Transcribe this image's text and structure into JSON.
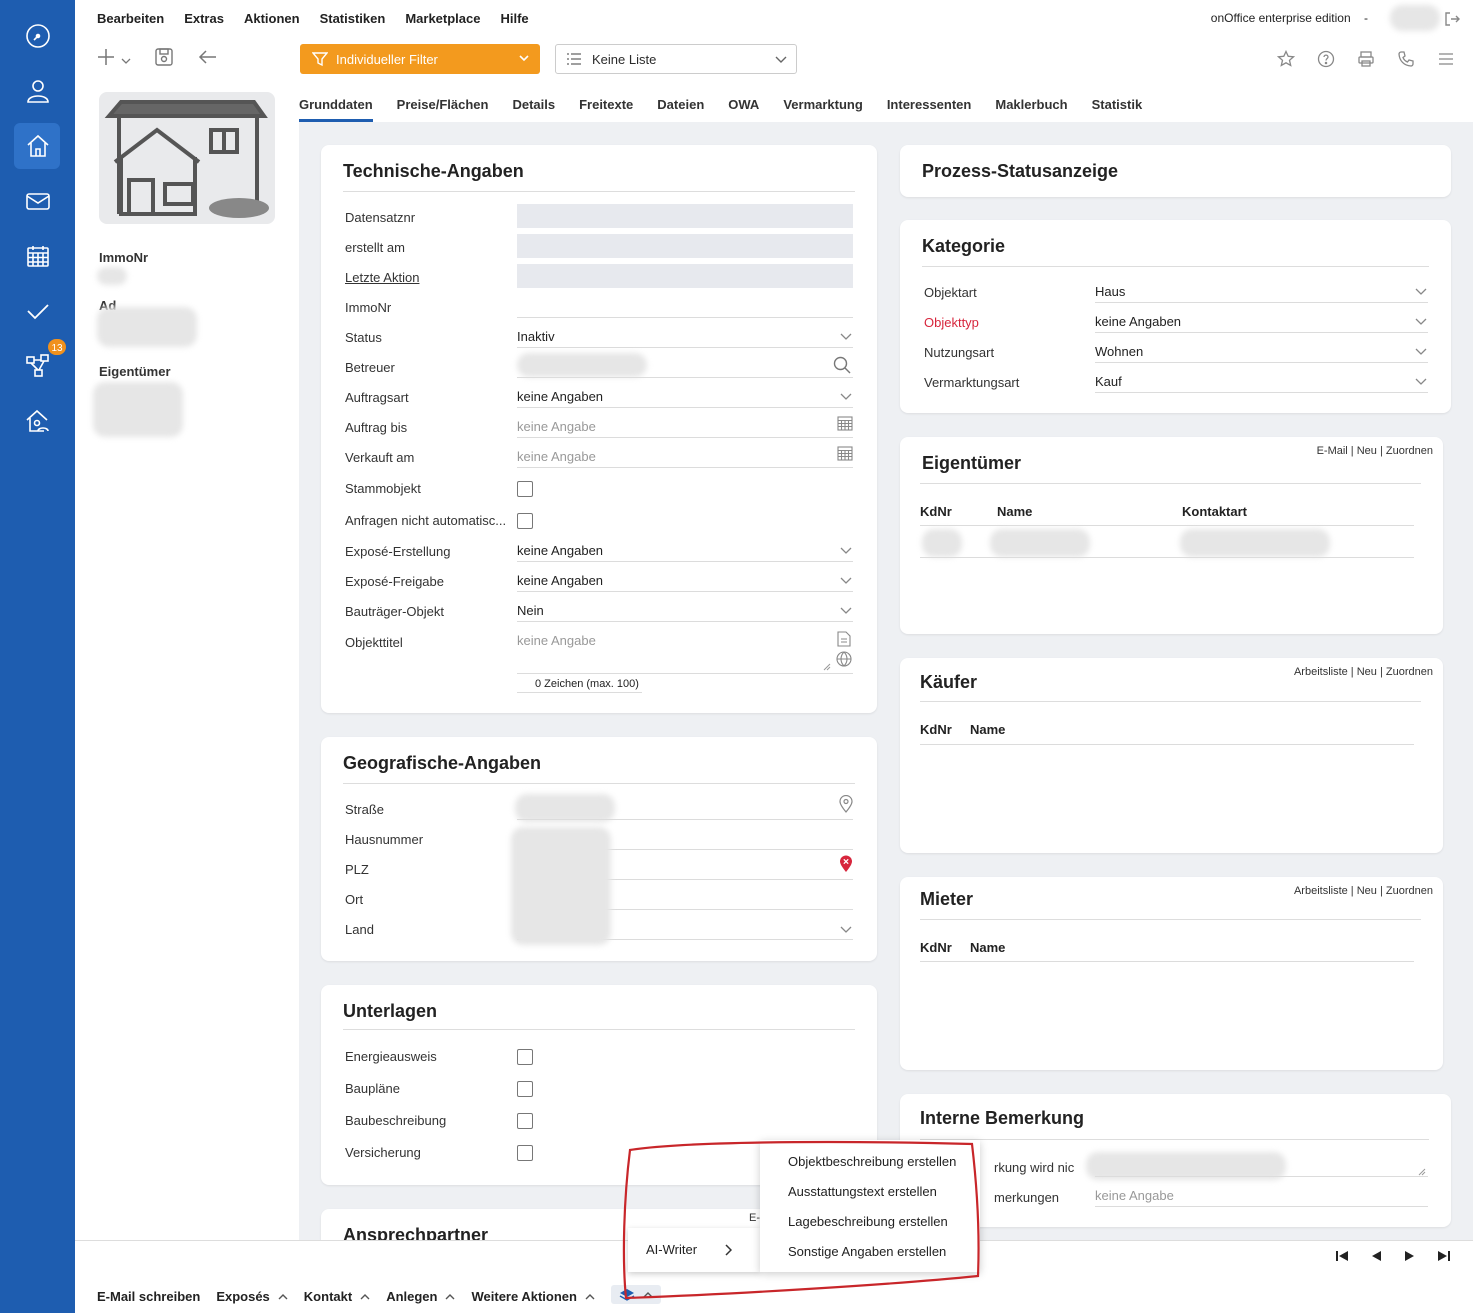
{
  "menu": [
    "Bearbeiten",
    "Extras",
    "Aktionen",
    "Statistiken",
    "Marketplace",
    "Hilfe"
  ],
  "edition": "onOffice enterprise edition",
  "edition_sep": "-",
  "nav_icons": [
    "dashboard-icon",
    "person-icon",
    "house-icon",
    "mail-icon",
    "calendar-icon",
    "check-icon",
    "workflow-icon",
    "house-person-icon"
  ],
  "nav_badge": "13",
  "filter": {
    "label": "Individueller Filter",
    "color": "#f39a1e"
  },
  "list_select": {
    "label": "Keine Liste"
  },
  "tabs": [
    "Grunddaten",
    "Preise/Flächen",
    "Details",
    "Freitexte",
    "Dateien",
    "OWA",
    "Vermarktung",
    "Interessenten",
    "Maklerbuch",
    "Statistik"
  ],
  "left": {
    "immonr_label": "ImmoNr",
    "adresse_label": "Ad",
    "eigentuemer_label": "Eigentümer"
  },
  "technisch": {
    "title": "Technische-Angaben",
    "rows": {
      "datensatznr": "Datensatznr",
      "erstellt": "erstellt am",
      "letzte_aktion": "Letzte Aktion",
      "immonr": "ImmoNr",
      "status": "Status",
      "status_value": "Inaktiv",
      "betreuer": "Betreuer",
      "auftragsart": "Auftragsart",
      "auftragsart_value": "keine Angaben",
      "auftrag_bis": "Auftrag bis",
      "auftrag_bis_placeholder": "keine Angabe",
      "verkauft_am": "Verkauft am",
      "verkauft_am_placeholder": "keine Angabe",
      "stammobjekt": "Stammobjekt",
      "anfragen": "Anfragen nicht automatisc...",
      "expose_erstellung": "Exposé-Erstellung",
      "expose_erstellung_value": "keine Angaben",
      "expose_freigabe": "Exposé-Freigabe",
      "expose_freigabe_value": "keine Angaben",
      "bautraeger": "Bauträger-Objekt",
      "bautraeger_value": "Nein",
      "objekttitel": "Objekttitel",
      "objekttitel_placeholder": "keine Angabe",
      "zeichen": "0 Zeichen (max. 100)"
    }
  },
  "geo": {
    "title": "Geografische-Angaben",
    "rows": {
      "strasse": "Straße",
      "hausnummer": "Hausnummer",
      "plz": "PLZ",
      "ort": "Ort",
      "land": "Land"
    }
  },
  "unterlagen": {
    "title": "Unterlagen",
    "rows": [
      "Energieausweis",
      "Baupläne",
      "Baubeschreibung",
      "Versicherung"
    ]
  },
  "ansprechpartner": {
    "title": "Ansprechpartner"
  },
  "prozess": {
    "title": "Prozess-Statusanzeige"
  },
  "kategorie": {
    "title": "Kategorie",
    "rows": [
      {
        "label": "Objektart",
        "value": "Haus"
      },
      {
        "label": "Objekttyp",
        "value": "keine Angaben"
      },
      {
        "label": "Nutzungsart",
        "value": "Wohnen"
      },
      {
        "label": "Vermarktungsart",
        "value": "Kauf"
      }
    ],
    "required_color": "#d7263d"
  },
  "eigentuemer": {
    "title": "Eigentümer",
    "links": [
      "E-Mail",
      "Neu",
      "Zuordnen"
    ],
    "columns": [
      "KdNr",
      "Name",
      "Kontaktart"
    ]
  },
  "kaeufer": {
    "title": "Käufer",
    "links": [
      "Arbeitsliste",
      "Neu",
      "Zuordnen"
    ],
    "columns": [
      "KdNr",
      "Name"
    ]
  },
  "mieter": {
    "title": "Mieter",
    "links": [
      "Arbeitsliste",
      "Neu",
      "Zuordnen"
    ],
    "columns": [
      "KdNr",
      "Name"
    ]
  },
  "interne": {
    "title": "Interne Bemerkung",
    "row1": "rkung wird nic",
    "row2": "merkungen",
    "row2_placeholder": "keine Angabe"
  },
  "popup": {
    "parent": "AI-Writer",
    "parent_partial": "E-",
    "items": [
      "Objektbeschreibung erstellen",
      "Ausstattungstext erstellen",
      "Lagebeschreibung erstellen",
      "Sonstige Angaben erstellen"
    ]
  },
  "bottom": {
    "actions": [
      "E-Mail schreiben",
      "Exposés",
      "Kontakt",
      "Anlegen",
      "Weitere Aktionen"
    ]
  }
}
